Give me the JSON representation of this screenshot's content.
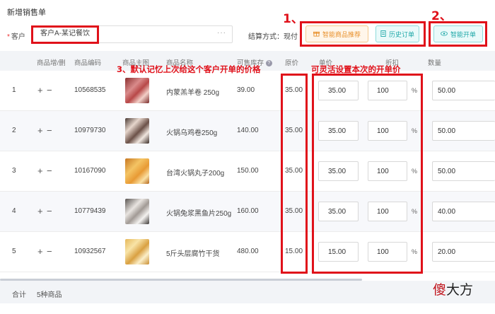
{
  "page": {
    "title": "新增销售单"
  },
  "customer": {
    "required_mark": "*",
    "label": "客户",
    "value": "客户A-某记餐饮",
    "picker_icon": "ellipsis-icon"
  },
  "settlement": {
    "label": "结算方式：现付"
  },
  "buttons": {
    "smart_recommend": {
      "label": "智能商品推荐",
      "icon": "gift-icon"
    },
    "history_orders": {
      "label": "历史订单",
      "icon": "document-icon"
    },
    "smart_order": {
      "label": "智能开单",
      "icon": "eye-icon"
    }
  },
  "annotations": {
    "one": "1、",
    "two": "2、",
    "three": "3、默认记忆上次给这个客户开单的价格",
    "four": "可灵活设置本次的开单价"
  },
  "table": {
    "headers": [
      "商品增/删",
      "商品编码",
      "商品主图",
      "商品名称",
      "可售库存",
      "原价",
      "单价",
      "折扣",
      "数量"
    ],
    "help_icon": "?",
    "increment": "+",
    "decrement": "−",
    "pct": "%",
    "rows": [
      {
        "idx": "1",
        "code": "10568535",
        "name": "内蒙羔羊卷 250g",
        "stock": "39.00",
        "orig": "35.00",
        "price": "35.00",
        "disc": "100",
        "qty": "50.00"
      },
      {
        "idx": "2",
        "code": "10979730",
        "name": "火锅乌鸡卷250g",
        "stock": "140.00",
        "orig": "35.00",
        "price": "35.00",
        "disc": "100",
        "qty": "50.00"
      },
      {
        "idx": "3",
        "code": "10167090",
        "name": "台湾火锅丸子200g",
        "stock": "150.00",
        "orig": "35.00",
        "price": "35.00",
        "disc": "100",
        "qty": "50.00"
      },
      {
        "idx": "4",
        "code": "10779439",
        "name": "火锅兔浆黑鱼片250g",
        "stock": "160.00",
        "orig": "35.00",
        "price": "35.00",
        "disc": "100",
        "qty": "40.00"
      },
      {
        "idx": "5",
        "code": "10932567",
        "name": "5斤头层腐竹干货",
        "stock": "480.00",
        "orig": "15.00",
        "price": "15.00",
        "disc": "100",
        "qty": "20.00"
      }
    ]
  },
  "footer": {
    "total_label": "合计",
    "count": "5种商品"
  },
  "watermark": {
    "big": "傻",
    "rest": "大方"
  },
  "colors": {
    "annotation_red": "#e0111a",
    "orange": "#e8912d",
    "teal": "#1fa8a8"
  }
}
